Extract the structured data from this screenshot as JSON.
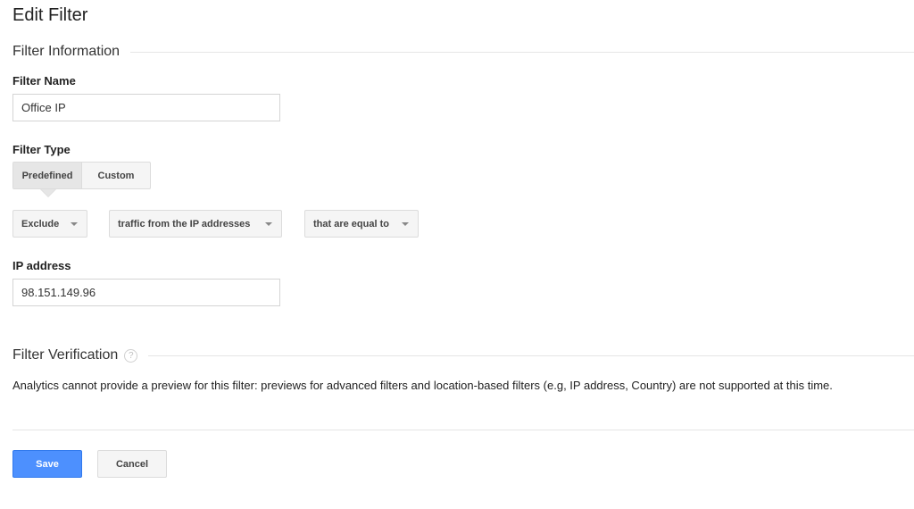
{
  "page": {
    "title": "Edit Filter"
  },
  "filter_information": {
    "section_title": "Filter Information",
    "filter_name": {
      "label": "Filter Name",
      "value": "Office IP"
    },
    "filter_type": {
      "label": "Filter Type",
      "options": [
        {
          "label": "Predefined",
          "selected": true
        },
        {
          "label": "Custom",
          "selected": false
        }
      ]
    },
    "dropdowns": {
      "action": "Exclude",
      "source": "traffic from the IP addresses",
      "expression": "that are equal to"
    },
    "ip_address": {
      "label": "IP address",
      "value": "98.151.149.96"
    }
  },
  "filter_verification": {
    "section_title": "Filter Verification",
    "help_icon": "?",
    "message": "Analytics cannot provide a preview for this filter: previews for advanced filters and location-based filters (e.g, IP address, Country) are not supported at this time."
  },
  "actions": {
    "save_label": "Save",
    "cancel_label": "Cancel"
  },
  "colors": {
    "primary": "#4d90fe",
    "divider": "#e5e5e5"
  }
}
